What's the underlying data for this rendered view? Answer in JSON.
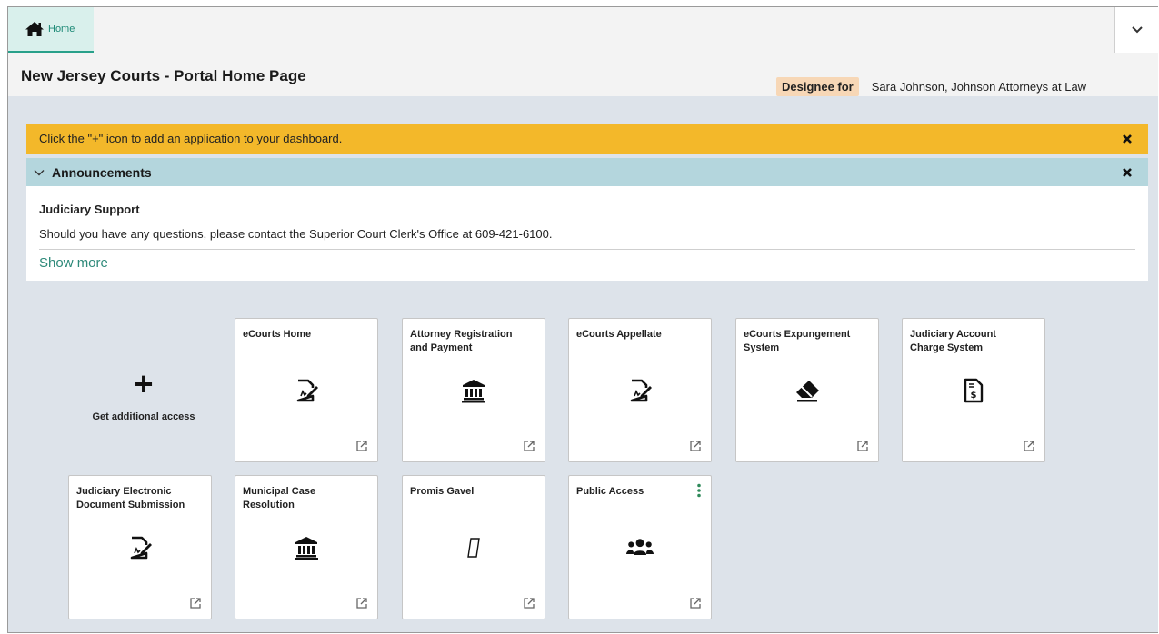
{
  "nav": {
    "home_tab": "Home"
  },
  "header": {
    "title": "New Jersey Courts - Portal Home Page",
    "designee_label": "Designee for",
    "designee_name": "Sara Johnson, Johnson Attorneys at Law"
  },
  "banner": {
    "text": "Click the \"+\" icon to add an application to your dashboard."
  },
  "announcements": {
    "heading": "Announcements",
    "item_title": "Judiciary Support",
    "item_text": "Should you have any questions, please contact the Superior Court Clerk's Office at 609-421-6100.",
    "show_more": "Show more"
  },
  "add_access": {
    "label": "Get additional access"
  },
  "tiles": [
    {
      "title": "eCourts Home",
      "icon": "document-sign-icon"
    },
    {
      "title": "Attorney Registration and Payment",
      "icon": "bank-icon"
    },
    {
      "title": "eCourts Appellate",
      "icon": "document-sign-icon"
    },
    {
      "title": "eCourts Expungement System",
      "icon": "eraser-icon"
    },
    {
      "title": "Judiciary Account Charge System",
      "icon": "invoice-icon"
    },
    {
      "title": "Judiciary Electronic Document Submission",
      "icon": "document-sign-icon"
    },
    {
      "title": "Municipal Case Resolution",
      "icon": "bank-icon"
    },
    {
      "title": "Promis Gavel",
      "icon": "missing-glyph-icon"
    },
    {
      "title": "Public Access",
      "icon": "users-icon"
    }
  ],
  "colors": {
    "banner": "#f3b82a",
    "announce_header": "#b4d6dd",
    "designee_badge": "#f7d7b6",
    "accent": "#2f8a7a"
  }
}
